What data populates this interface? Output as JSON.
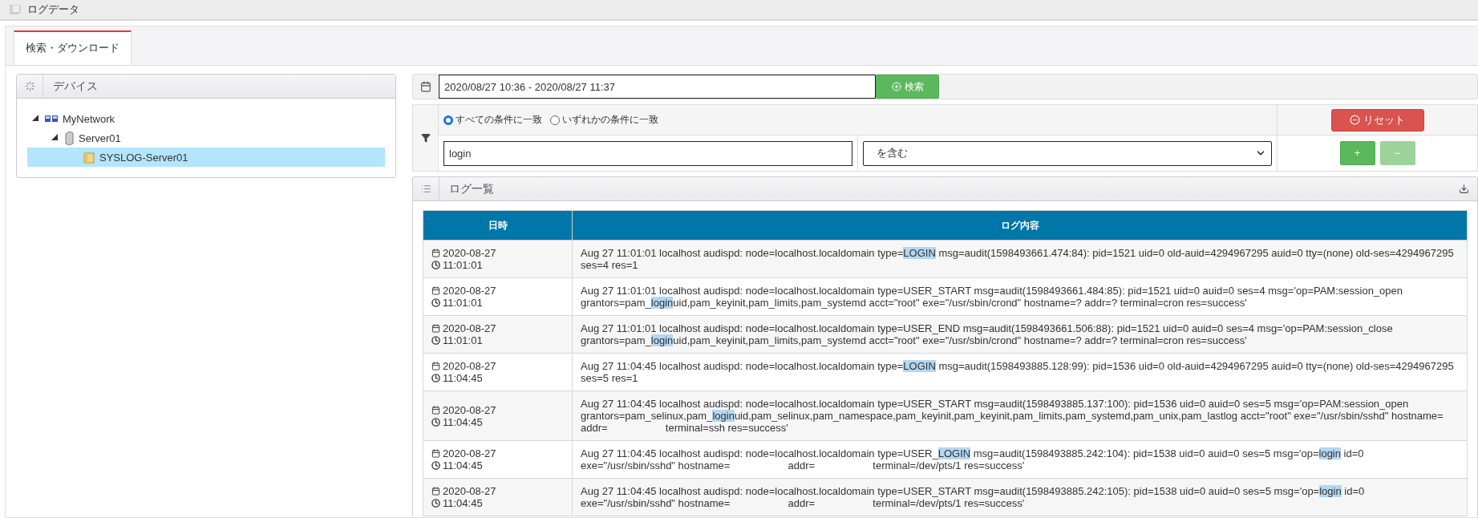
{
  "header": {
    "title": "ログデータ"
  },
  "tabs": [
    {
      "label": "検索・ダウンロード",
      "selected": true
    }
  ],
  "device_panel": {
    "title": "デバイス",
    "tree": [
      {
        "label": "MyNetwork",
        "kind": "network",
        "expanded": true,
        "selected": false,
        "children": [
          {
            "label": "Server01",
            "kind": "server",
            "expanded": true,
            "selected": false,
            "children": [
              {
                "label": "SYSLOG-Server01",
                "kind": "log",
                "selected": true
              }
            ]
          }
        ]
      }
    ]
  },
  "search": {
    "date_range": "2020/08/27 10:36 - 2020/08/27 11:37",
    "search_button": "検索"
  },
  "filter": {
    "match_modes": [
      {
        "label": "すべての条件に一致",
        "selected": true
      },
      {
        "label": "いずれかの条件に一致",
        "selected": false
      }
    ],
    "reset_button": "リセット",
    "condition": {
      "value": "login",
      "operator": "を含む"
    },
    "add_button": {
      "label": "+",
      "disabled": false
    },
    "remove_button": {
      "label": "−",
      "disabled": true
    }
  },
  "log_list": {
    "title": "ログ一覧",
    "columns": [
      "日時",
      "ログ内容"
    ],
    "rows": [
      {
        "date": "2020-08-27",
        "time": "11:01:01",
        "content": [
          {
            "text": "Aug 27 11:01:01 localhost audispd: node=localhost.localdomain type=",
            "highlighted": false
          },
          {
            "text": "LOGIN",
            "highlighted": true
          },
          {
            "text": " msg=audit(1598493661.474:84): pid=1521 uid=0 old-auid=4294967295 auid=0 tty=(none) old-ses=4294967295 ses=4 res=1",
            "highlighted": false
          }
        ]
      },
      {
        "date": "2020-08-27",
        "time": "11:01:01",
        "content": [
          {
            "text": "Aug 27 11:01:01 localhost audispd: node=localhost.localdomain type=USER_START msg=audit(1598493661.484:85): pid=1521 uid=0 auid=0 ses=4 msg='op=PAM:session_open grantors=pam_",
            "highlighted": false
          },
          {
            "text": "login",
            "highlighted": true
          },
          {
            "text": "uid,pam_keyinit,pam_limits,pam_systemd acct=\"root\" exe=\"/usr/sbin/crond\" hostname=? addr=? terminal=cron res=success'",
            "highlighted": false
          }
        ]
      },
      {
        "date": "2020-08-27",
        "time": "11:01:01",
        "content": [
          {
            "text": "Aug 27 11:01:01 localhost audispd: node=localhost.localdomain type=USER_END msg=audit(1598493661.506:88): pid=1521 uid=0 auid=0 ses=4 msg='op=PAM:session_close grantors=pam_",
            "highlighted": false
          },
          {
            "text": "login",
            "highlighted": true
          },
          {
            "text": "uid,pam_keyinit,pam_limits,pam_systemd acct=\"root\" exe=\"/usr/sbin/crond\" hostname=? addr=? terminal=cron res=success'",
            "highlighted": false
          }
        ]
      },
      {
        "date": "2020-08-27",
        "time": "11:04:45",
        "content": [
          {
            "text": "Aug 27 11:04:45 localhost audispd: node=localhost.localdomain type=",
            "highlighted": false
          },
          {
            "text": "LOGIN",
            "highlighted": true
          },
          {
            "text": " msg=audit(1598493885.128:99): pid=1536 uid=0 old-auid=4294967295 auid=0 tty=(none) old-ses=4294967295 ses=5 res=1",
            "highlighted": false
          }
        ]
      },
      {
        "date": "2020-08-27",
        "time": "11:04:45",
        "content": [
          {
            "text": "Aug 27 11:04:45 localhost audispd: node=localhost.localdomain type=USER_START msg=audit(1598493885.137:100): pid=1536 uid=0 auid=0 ses=5 msg='op=PAM:session_open grantors=pam_selinux,pam_",
            "highlighted": false
          },
          {
            "text": "login",
            "highlighted": true
          },
          {
            "text": "uid,pam_selinux,pam_namespace,pam_keyinit,pam_keyinit,pam_limits,pam_systemd,pam_unix,pam_lastlog acct=\"root\" exe=\"/usr/sbin/sshd\" hostname=                    addr=                    terminal=ssh res=success'",
            "highlighted": false
          }
        ]
      },
      {
        "date": "2020-08-27",
        "time": "11:04:45",
        "content": [
          {
            "text": "Aug 27 11:04:45 localhost audispd: node=localhost.localdomain type=USER_",
            "highlighted": false
          },
          {
            "text": "LOGIN",
            "highlighted": true
          },
          {
            "text": " msg=audit(1598493885.242:104): pid=1538 uid=0 auid=0 ses=5 msg='op=",
            "highlighted": false
          },
          {
            "text": "login",
            "highlighted": true
          },
          {
            "text": " id=0 exe=\"/usr/sbin/sshd\" hostname=                    addr=                    terminal=/dev/pts/1 res=success'",
            "highlighted": false
          }
        ]
      },
      {
        "date": "2020-08-27",
        "time": "11:04:45",
        "content": [
          {
            "text": "Aug 27 11:04:45 localhost audispd: node=localhost.localdomain type=USER_START msg=audit(1598493885.242:105): pid=1538 uid=0 auid=0 ses=5 msg='op=",
            "highlighted": false
          },
          {
            "text": "login",
            "highlighted": true
          },
          {
            "text": " id=0 exe=\"/usr/sbin/sshd\" hostname=                    addr=                    terminal=/dev/pts/1 res=success'",
            "highlighted": false
          }
        ]
      }
    ]
  }
}
